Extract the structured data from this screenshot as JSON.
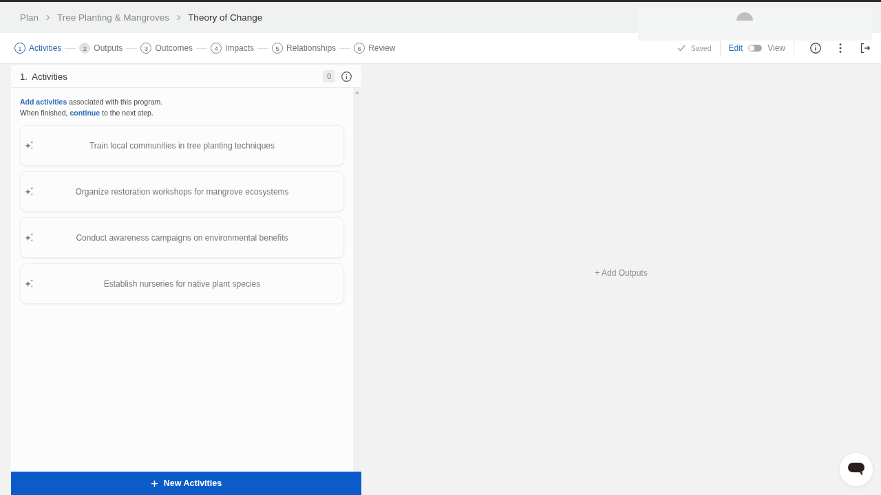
{
  "breadcrumb": [
    {
      "label": "Plan",
      "current": false
    },
    {
      "label": "Tree Planting & Mangroves",
      "current": false
    },
    {
      "label": "Theory of Change",
      "current": true
    }
  ],
  "steps": [
    {
      "number": "1",
      "label": "Activities",
      "selected": true,
      "filled": false
    },
    {
      "number": "2",
      "label": "Outputs",
      "selected": false,
      "filled": true
    },
    {
      "number": "3",
      "label": "Outcomes",
      "selected": false,
      "filled": false
    },
    {
      "number": "4",
      "label": "Impacts",
      "selected": false,
      "filled": false
    },
    {
      "number": "5",
      "label": "Relationships",
      "selected": false,
      "filled": false
    },
    {
      "number": "6",
      "label": "Review",
      "selected": false,
      "filled": false
    }
  ],
  "status": "Saved",
  "mode_toggle": {
    "left": "Edit",
    "right": "View",
    "on": false
  },
  "panel": {
    "title": "1.  Activities",
    "count": "0",
    "intro": "**Add activities** associated with this program.",
    "intro_2": "When finished, **continue** to the next step.",
    "items": [
      "Train local communities in tree planting techniques",
      "Organize restoration workshops for mangrove ecosystems",
      "Conduct awareness campaigns on environmental benefits",
      "Establish nurseries for native plant species"
    ],
    "button": "New Activities"
  },
  "add_outputs": "+ Add Outputs"
}
